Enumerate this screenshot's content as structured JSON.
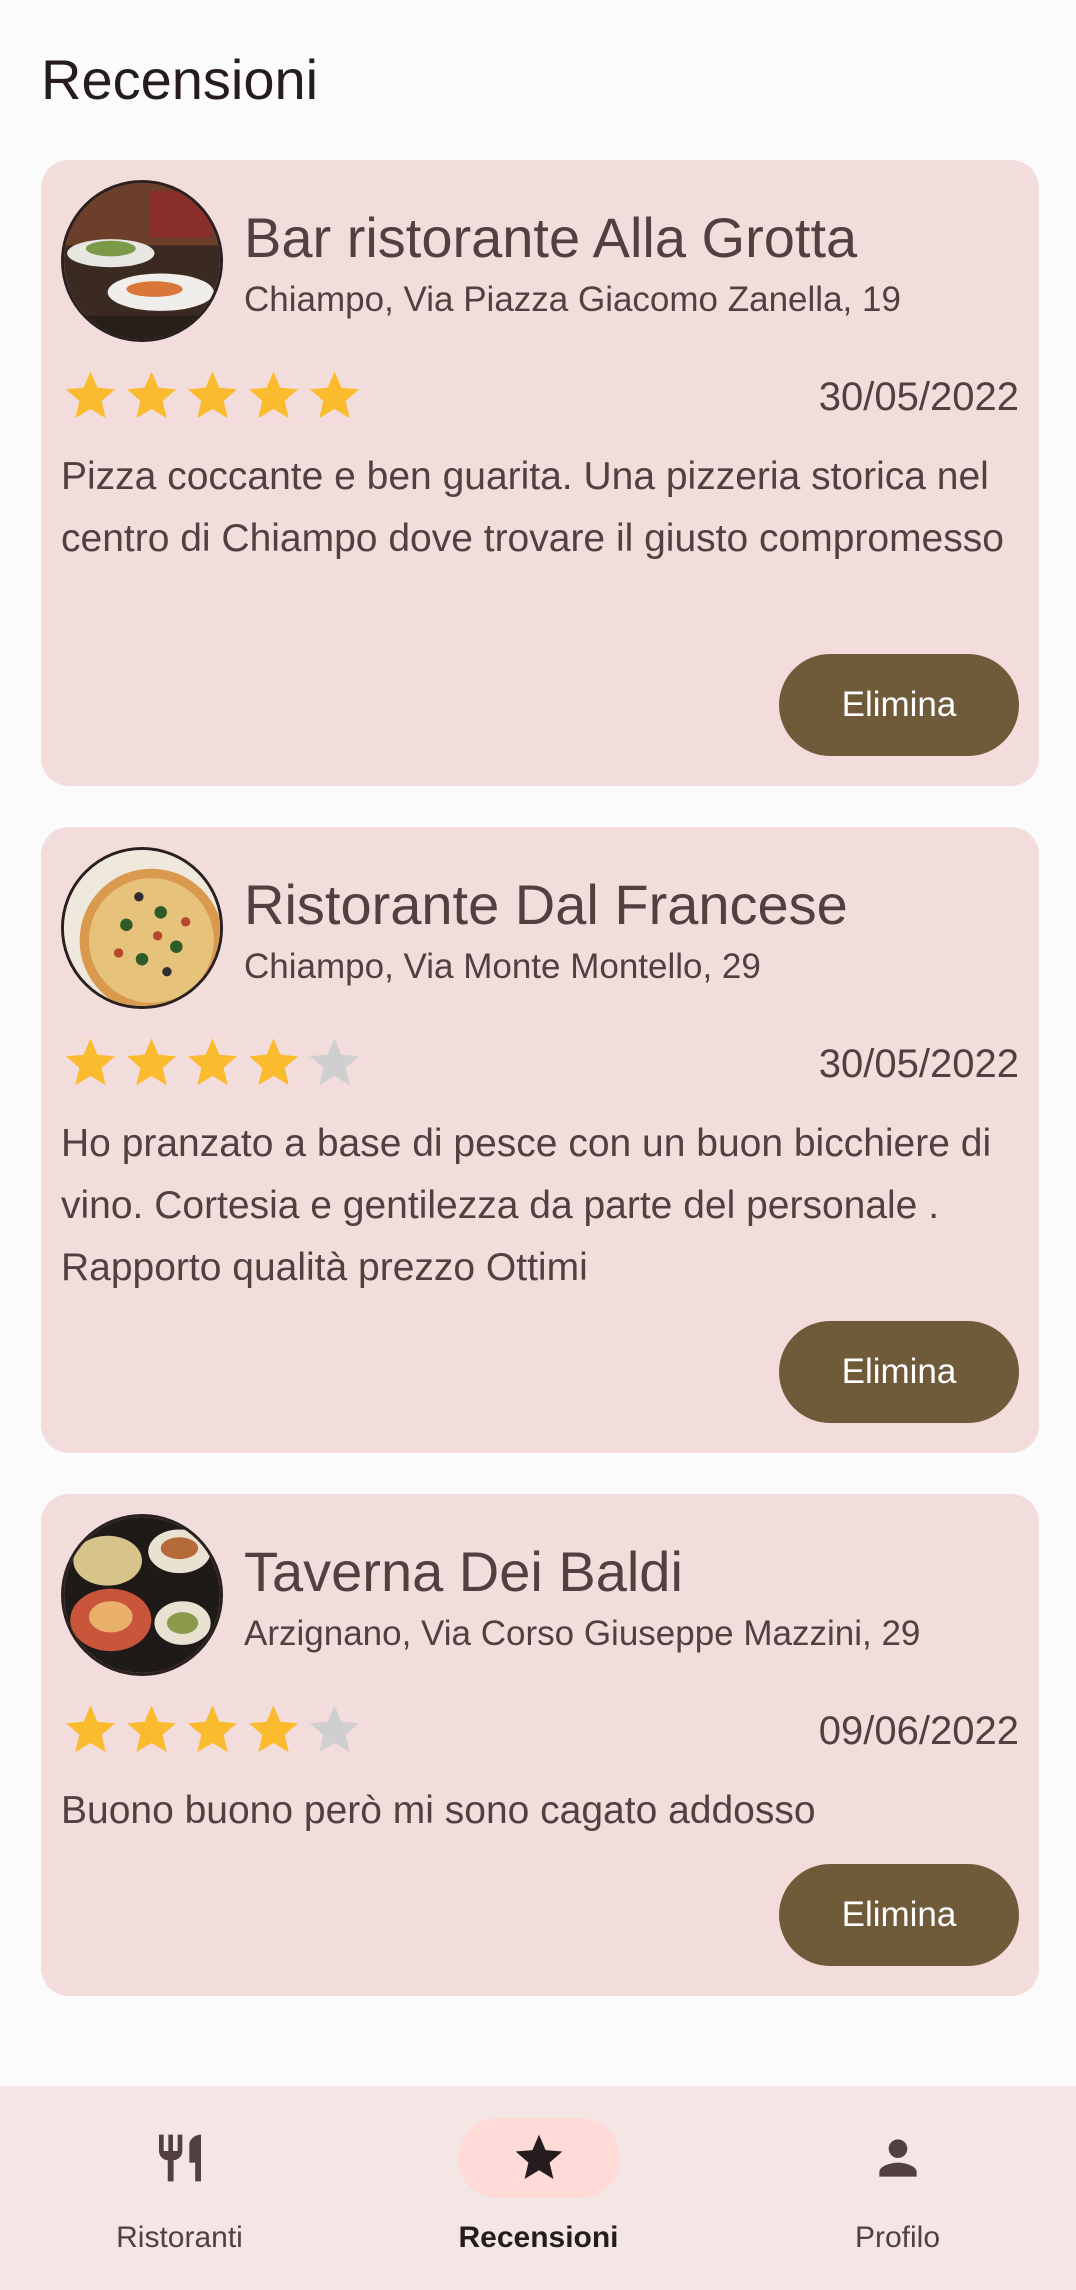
{
  "page": {
    "title": "Recensioni"
  },
  "reviews": [
    {
      "restaurant": "Bar ristorante Alla Grotta",
      "address": "Chiampo, Via  Piazza Giacomo Zanella, 19",
      "rating": 5,
      "max_rating": 5,
      "date": "30/05/2022",
      "text": "Pizza coccante e ben guarita. Una pizzeria storica nel centro di Chiampo dove trovare il giusto compromesso",
      "delete_label": "Elimina",
      "image": "restaurant-dishes-photo"
    },
    {
      "restaurant": "Ristorante Dal Francese",
      "address": "Chiampo, Via  Monte Montello, 29",
      "rating": 4,
      "max_rating": 5,
      "date": "30/05/2022",
      "text": "Ho pranzato a base di pesce con un buon bicchiere di vino. Cortesia e gentilezza da parte del personale . Rapporto qualità prezzo Ottimi",
      "delete_label": "Elimina",
      "image": "pizza-photo"
    },
    {
      "restaurant": "Taverna Dei Baldi",
      "address": "Arzignano, Via  Corso Giuseppe Mazzini, 29",
      "rating": 4,
      "max_rating": 5,
      "date": "09/06/2022",
      "text": "Buono buono però mi sono cagato addosso",
      "delete_label": "Elimina",
      "image": "food-table-photo"
    }
  ],
  "nav": {
    "items": [
      {
        "label": "Ristoranti",
        "icon": "restaurant-icon",
        "active": false
      },
      {
        "label": "Recensioni",
        "icon": "star-icon",
        "active": true
      },
      {
        "label": "Profilo",
        "icon": "person-icon",
        "active": false
      }
    ]
  },
  "colors": {
    "card_bg": "#f3dddc",
    "button_bg": "#6f5a3a",
    "star_filled": "#fbbb2e",
    "star_empty": "#cfcfcf",
    "nav_bg": "#f5e6e6",
    "nav_active_pill": "#ffdad6"
  }
}
